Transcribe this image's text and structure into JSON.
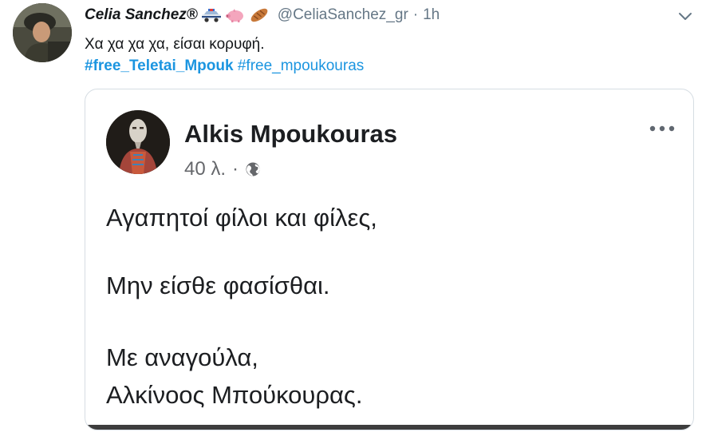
{
  "tweet": {
    "author": {
      "display_name": "Celia Sanchez®",
      "emoji_icons": [
        "police-car-icon",
        "pig-icon",
        "bread-icon"
      ],
      "handle": "@CeliaSanchez_gr",
      "separator": "·",
      "time": "1h"
    },
    "text": "Χα χα χα χα, είσαι κορυφή.",
    "hashtags": [
      "#free_Teletai_Mpouk",
      "#free_mpoukouras"
    ],
    "menu_icon": "chevron-down-icon"
  },
  "embedded_post": {
    "author_name": "Alkis Mpoukouras",
    "time": "40 λ.",
    "separator": "·",
    "privacy_icon": "globe-icon",
    "more_icon": "more-options-icon",
    "lines": [
      "Αγαπητοί φίλοι και φίλες,",
      "Μην είσθε φασίσθαι.",
      "Με αναγούλα,",
      "Αλκίνοος Μπούκουρας."
    ]
  },
  "colors": {
    "link": "#1b95e0",
    "secondary_text": "#657786",
    "card_border": "#d6dde3",
    "fb_secondary": "#65676b"
  }
}
